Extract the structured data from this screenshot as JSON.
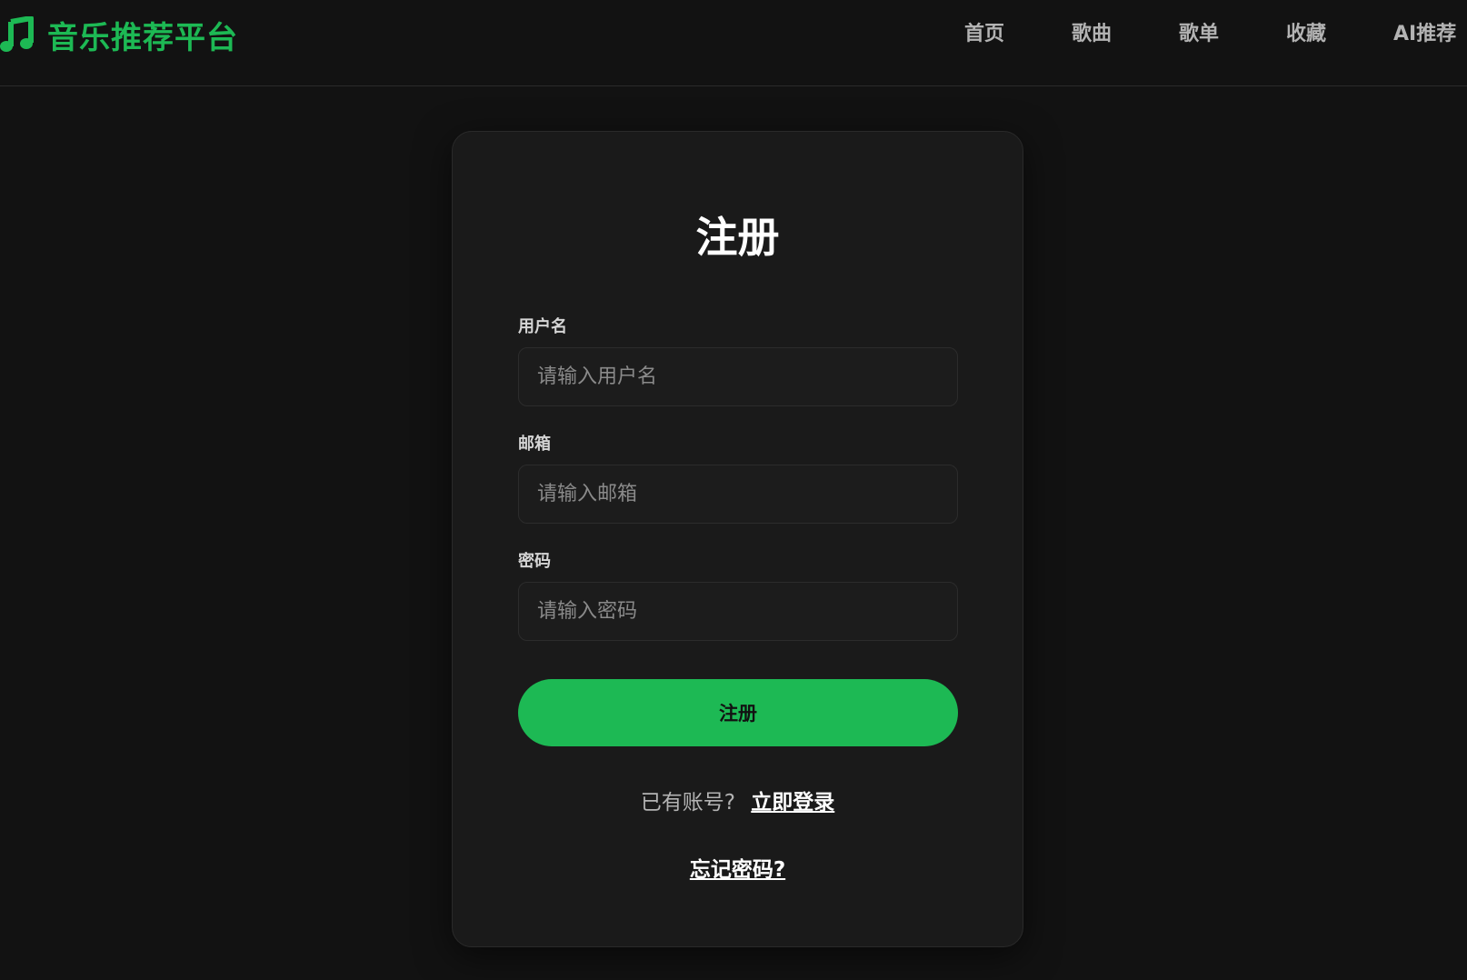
{
  "brand": {
    "icon": "music-note-icon",
    "title": "音乐推荐平台",
    "color": "#1db954"
  },
  "nav": {
    "items": [
      {
        "label": "首页"
      },
      {
        "label": "歌曲"
      },
      {
        "label": "歌单"
      },
      {
        "label": "收藏"
      },
      {
        "label": "AI推荐"
      }
    ]
  },
  "form": {
    "title": "注册",
    "username": {
      "label": "用户名",
      "placeholder": "请输入用户名",
      "value": ""
    },
    "email": {
      "label": "邮箱",
      "placeholder": "请输入邮箱",
      "value": ""
    },
    "password": {
      "label": "密码",
      "placeholder": "请输入密码",
      "value": ""
    },
    "submit_label": "注册",
    "has_account_text": "已有账号?",
    "login_link": "立即登录",
    "forgot_link": "忘记密码?"
  },
  "colors": {
    "accent": "#1db954",
    "background": "#121212",
    "card": "#1a1a1a"
  }
}
